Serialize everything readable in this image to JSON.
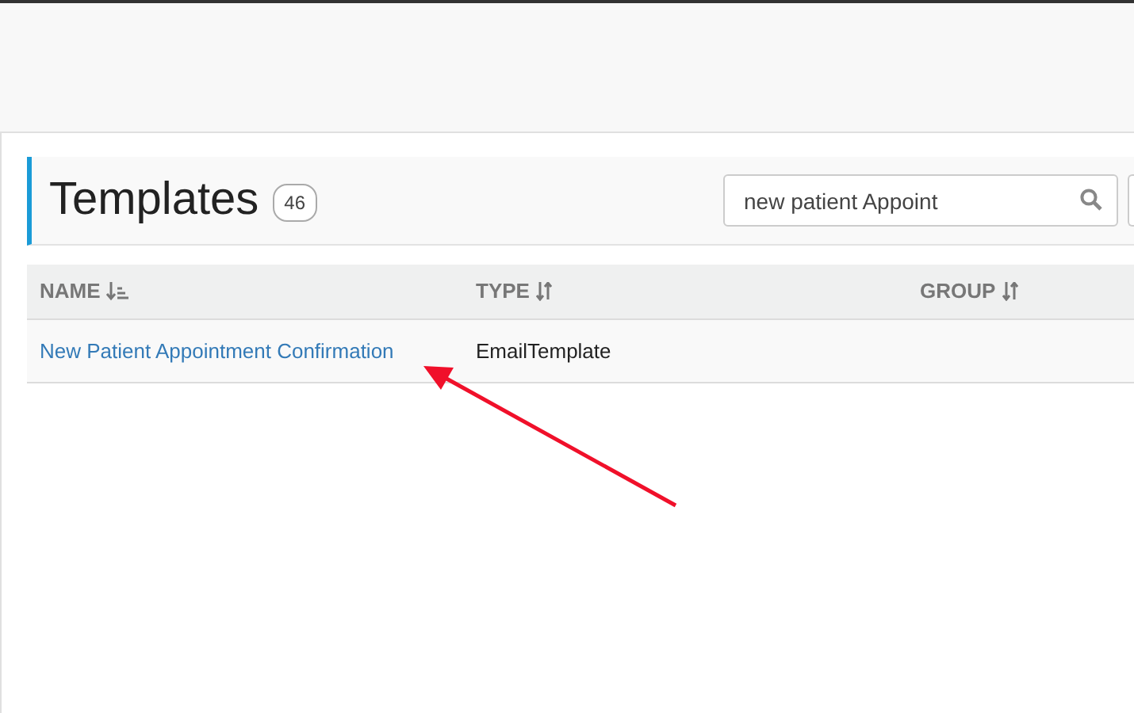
{
  "page": {
    "title": "Templates",
    "count": "46"
  },
  "search": {
    "value": "new patient Appoint"
  },
  "table": {
    "columns": [
      {
        "label": "NAME",
        "kind": "sorted"
      },
      {
        "label": "TYPE",
        "kind": "sortable"
      },
      {
        "label": "GROUP",
        "kind": "sortable"
      }
    ],
    "rows": [
      {
        "name": "New Patient Appointment Confirmation",
        "type": "EmailTemplate"
      }
    ]
  }
}
